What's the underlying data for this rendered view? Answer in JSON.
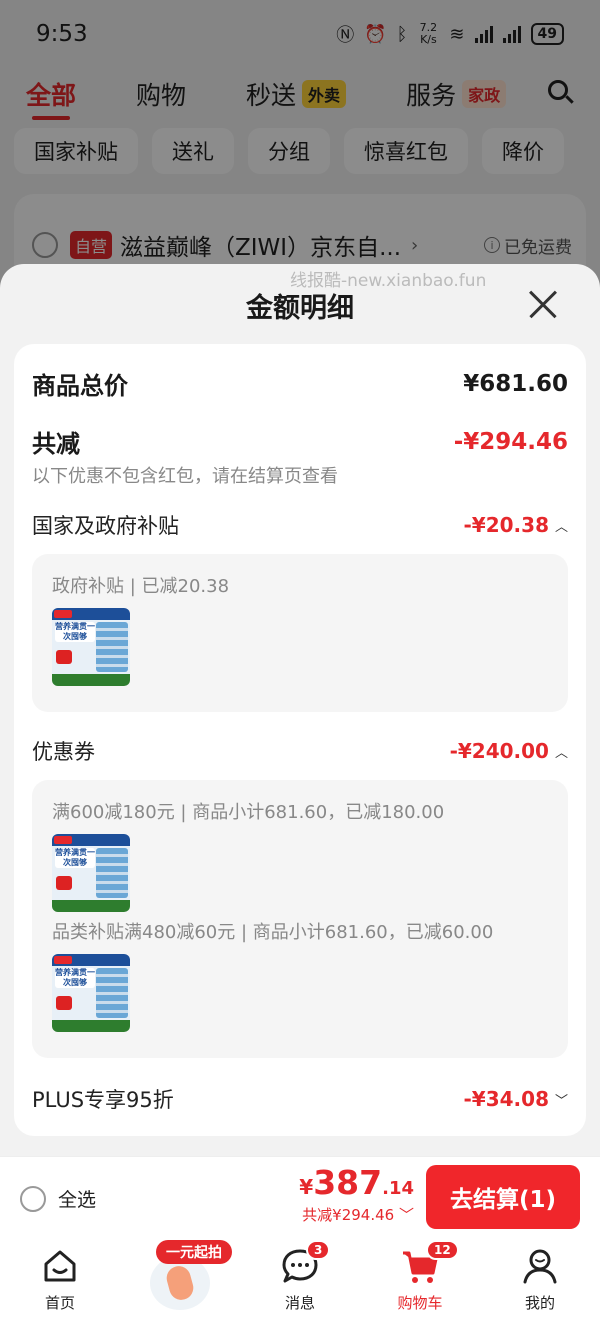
{
  "status_bar": {
    "time": "9:53",
    "net_speed_value": "7.2",
    "net_speed_unit": "K/s",
    "battery": "49"
  },
  "top_tabs": [
    {
      "label": "全部",
      "tag": ""
    },
    {
      "label": "购物",
      "tag": ""
    },
    {
      "label": "秒送",
      "tag": "外卖"
    },
    {
      "label": "服务",
      "tag": "家政"
    }
  ],
  "filters": [
    "国家补贴",
    "送礼",
    "分组",
    "惊喜红包",
    "降价"
  ],
  "store": {
    "self_tag": "自营",
    "name": "滋益巅峰（ZIWI）京东自...",
    "shipping": "已免运费"
  },
  "watermark": "线报酷-new.xianbao.fun",
  "sheet": {
    "title": "金额明细",
    "total_label": "商品总价",
    "total_value": "¥681.60",
    "discount_label": "共减",
    "discount_value": "-¥294.46",
    "discount_note": "以下优惠不包含红包，请在结算页查看",
    "subsidy": {
      "label": "国家及政府补贴",
      "value": "-¥20.38",
      "line": "政府补贴 | 已减20.38"
    },
    "coupon": {
      "label": "优惠券",
      "value": "-¥240.00",
      "line1": "满600减180元 | 商品小计681.60，已减180.00",
      "line2": "品类补贴满480减60元 | 商品小计681.60，已减60.00"
    },
    "plus": {
      "label": "PLUS专享95折",
      "value": "-¥34.08"
    },
    "thumb_text": "营养满贯一次囤够"
  },
  "checkout": {
    "select_all": "全选",
    "currency": "¥",
    "price_int": "387",
    "price_dec": ".14",
    "saved": "共减¥294.46",
    "button": "去结算(1)"
  },
  "tab_bar": {
    "home": "首页",
    "promo": "一元起拍",
    "messages": "消息",
    "messages_badge": "3",
    "cart": "购物车",
    "cart_badge": "12",
    "me": "我的"
  },
  "colors": {
    "accent": "#e5282c",
    "checkout_button": "#f0262b"
  }
}
